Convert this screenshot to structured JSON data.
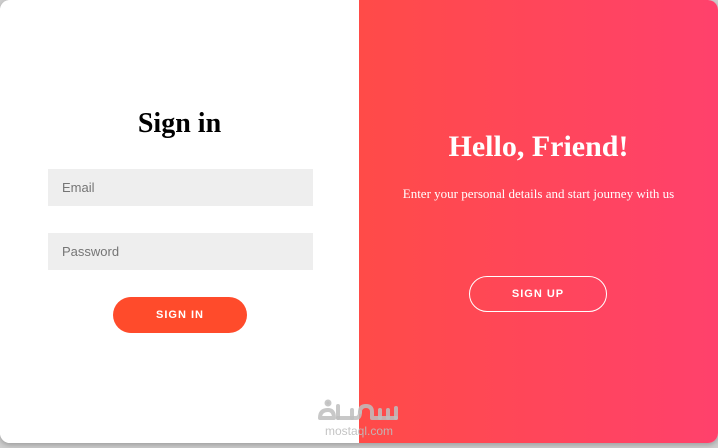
{
  "signin": {
    "title": "Sign in",
    "email_placeholder": "Email",
    "password_placeholder": "Password",
    "button_label": "SIGN IN"
  },
  "overlay": {
    "title": "Hello, Friend!",
    "text": "Enter your personal details and start journey with us",
    "button_label": "SIGN UP"
  },
  "watermark": {
    "text": "mostaql.com"
  },
  "colors": {
    "accent": "#ff4b2b",
    "gradient_start": "#ff4b48",
    "gradient_end": "#ff416c",
    "input_bg": "#eeeeee"
  }
}
